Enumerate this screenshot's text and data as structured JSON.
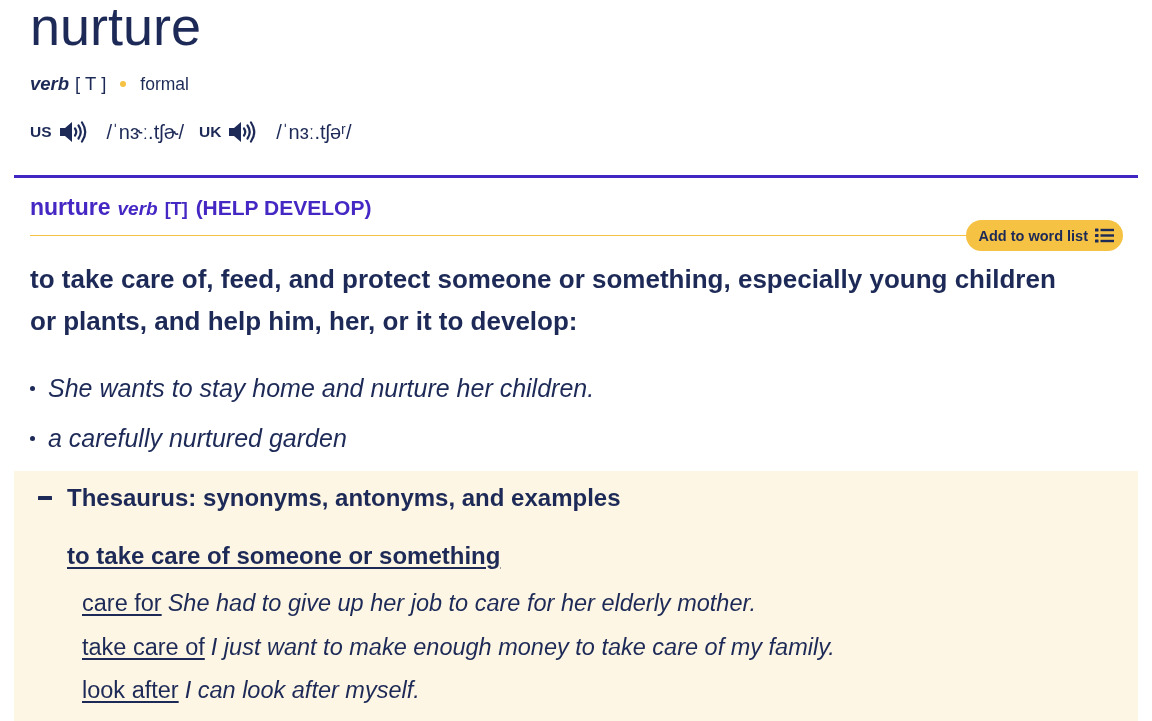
{
  "entry": {
    "headword": "nurture",
    "grammar": {
      "part_of_speech": "verb",
      "code": "[ T ]",
      "register": "formal"
    },
    "pronunciations": [
      {
        "region": "US",
        "ipa": "/ˈnɝː.tʃɚ/"
      },
      {
        "region": "UK",
        "ipa": "/ˈnɜː.tʃəʳ/"
      }
    ]
  },
  "sense": {
    "headword": "nurture",
    "part_of_speech": "verb",
    "code": "[T]",
    "guideword": "(HELP DEVELOP)",
    "add_button": "Add to word list",
    "definition": "to take care of, feed, and protect someone or something, especially young children or plants, and help him, her, or it to develop:",
    "examples": [
      "She wants to stay home and nurture her children.",
      "a carefully nurtured garden"
    ]
  },
  "thesaurus": {
    "expanded": true,
    "title": "Thesaurus: synonyms, antonyms, and examples",
    "groups": [
      {
        "heading": "to take care of someone or something",
        "entries": [
          {
            "term": "care for",
            "example": "She had to give up her job to care for her elderly mother."
          },
          {
            "term": "take care of",
            "example": "I just want to make enough money to take care of my family."
          },
          {
            "term": "look after",
            "example": "I can look after myself."
          }
        ]
      }
    ]
  }
}
